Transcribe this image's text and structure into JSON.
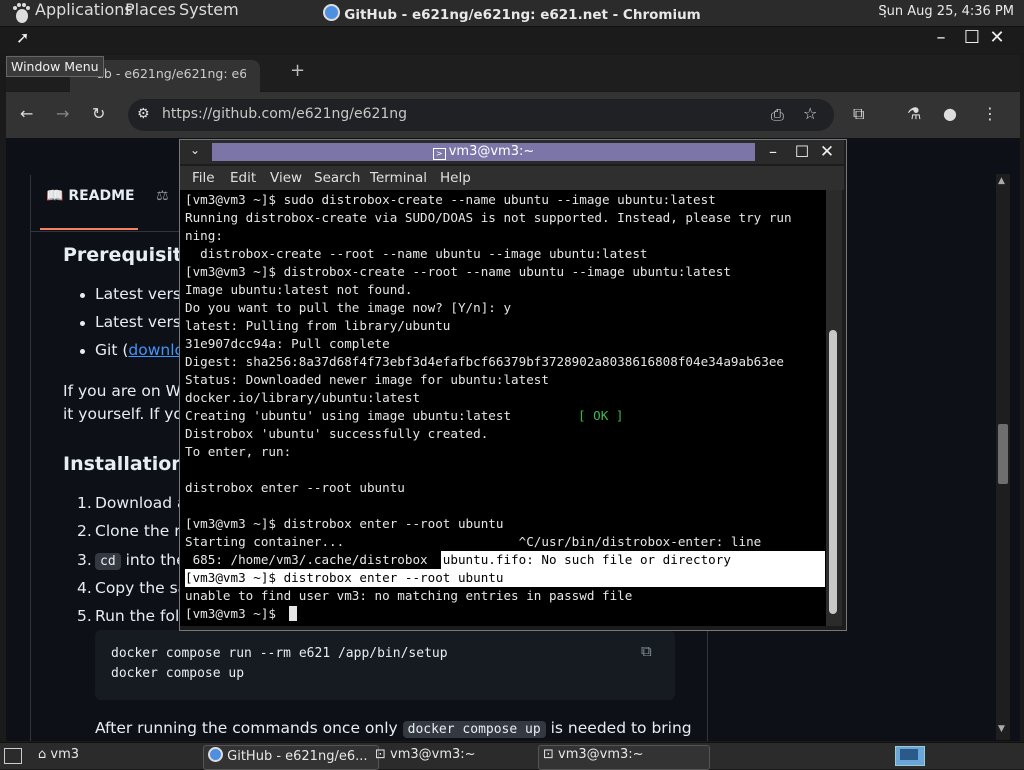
{
  "top_panel": {
    "applications": "Applications",
    "places": "Places",
    "system": "System",
    "clock": "Sun Aug 25,  4:36 PM"
  },
  "browser": {
    "window_title": "GitHub - e621ng/e621ng: e621.net - Chromium",
    "tab_title": "ub - e621ng/e621ng: e6...",
    "window_menu_tooltip": "Window Menu",
    "url": "https://github.com/e621ng/e621ng",
    "readme_tab": "README"
  },
  "page": {
    "h_prereq": "Prerequisite",
    "li1": "Latest versi",
    "li2": "Latest versi",
    "li3_pre": "Git (",
    "li3_link": "downlo",
    "p1_line1": "If you are on Wi",
    "p1_line2": "it yourself. If you",
    "h_install": "Installation",
    "step1": "Download a",
    "step2": "Clone the re",
    "step3_code": "cd",
    "step3_rest": " into the",
    "step4": "Copy the sa",
    "step5": "Run the follo",
    "code1": "docker compose run --rm e621 /app/bin/setup",
    "code2": "docker compose up",
    "after_pre": "After running the commands once only ",
    "after_code": "docker compose up",
    "after_post": " is needed to bring",
    "nums": [
      "1.",
      "2.",
      "3.",
      "4.",
      "5."
    ]
  },
  "terminal": {
    "title": "vm3@vm3:~",
    "menu": [
      "File",
      "Edit",
      "View",
      "Search",
      "Terminal",
      "Help"
    ],
    "lines": [
      "[vm3@vm3 ~]$ sudo distrobox-create --name ubuntu --image ubuntu:latest",
      "Running distrobox-create via SUDO/DOAS is not supported. Instead, please try run",
      "ning:",
      "  distrobox-create --root --name ubuntu --image ubuntu:latest",
      "[vm3@vm3 ~]$ distrobox-create --root --name ubuntu --image ubuntu:latest",
      "Image ubuntu:latest not found.",
      "Do you want to pull the image now? [Y/n]: y",
      "latest: Pulling from library/ubuntu",
      "31e907dcc94a: Pull complete",
      "Digest: sha256:8a37d68f4f73ebf3d4efafbcf66379bf3728902a8038616808f04e34a9ab63ee",
      "Status: Downloaded newer image for ubuntu:latest",
      "docker.io/library/ubuntu:latest",
      "Creating 'ubuntu' using image ubuntu:latest      ",
      "Distrobox 'ubuntu' successfully created.",
      "To enter, run:",
      "",
      "distrobox enter --root ubuntu",
      "",
      "[vm3@vm3 ~]$ distrobox enter --root ubuntu",
      "Starting container...                       ^C/usr/bin/distrobox-enter: line"
    ],
    "ok": "[ OK ]",
    "sel_line_pre": " 685: /home/vm3/.cache/distrobox",
    "sel_line_post": "/.ubuntu.fifo: No such file or directory",
    "sel_line2": "[vm3@vm3 ~]$ distrobox enter --root ubuntu",
    "line_unable": "unable to find user vm3: no matching entries in passwd file",
    "prompt": "[vm3@vm3 ~]$ "
  },
  "taskbar": {
    "vm3": "vm3",
    "github": "GitHub - e621ng/e6...",
    "term1": "vm3@vm3:~",
    "term2": "vm3@vm3:~"
  },
  "colors": {
    "github_bg": "#0d1117",
    "terminal_title_highlight": "#7c76a8",
    "ok_green": "#3fb950",
    "readme_underline": "#f78166"
  }
}
